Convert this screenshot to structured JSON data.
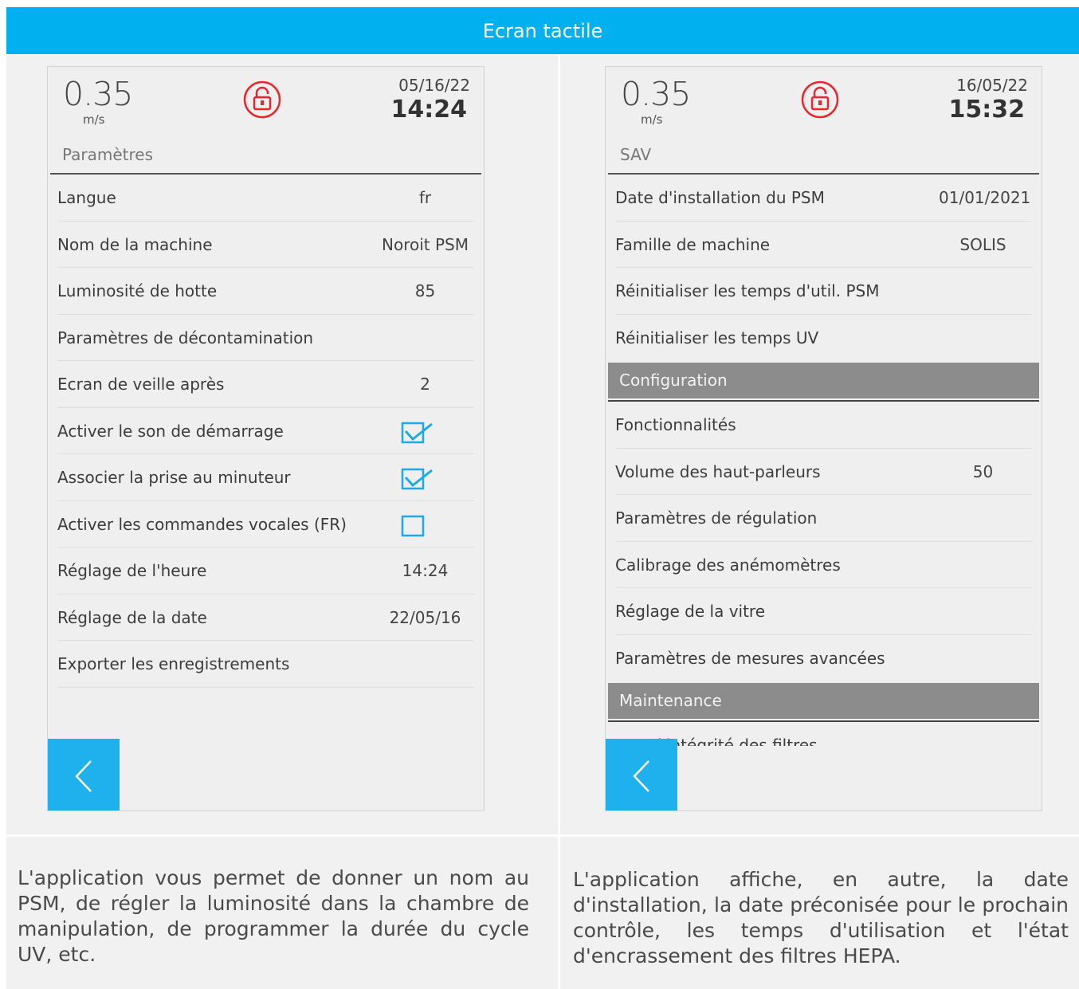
{
  "banner": {
    "title": "Ecran tactile"
  },
  "left_screen": {
    "speed": "0.35",
    "unit": "m/s",
    "date": "05/16/22",
    "time": "14:24",
    "section": "Paramètres",
    "lock_icon": "lock-icon",
    "lock_color": "#e8262b",
    "rows": [
      {
        "label": "Langue",
        "value": "fr"
      },
      {
        "label": "Nom de la machine",
        "value": "Noroit PSM"
      },
      {
        "label": "Luminosité de hotte",
        "value": "85"
      },
      {
        "label": "Paramètres de décontamination",
        "value": ""
      },
      {
        "label": "Ecran de veille après",
        "value": "2"
      },
      {
        "label": "Activer le son de démarrage",
        "checked": true
      },
      {
        "label": "Associer la prise au minuteur",
        "checked": true
      },
      {
        "label": "Activer les commandes vocales (FR)",
        "checked": false
      },
      {
        "label": "Réglage de l'heure",
        "value": "14:24"
      },
      {
        "label": "Réglage de la date",
        "value": "22/05/16"
      },
      {
        "label": "Exporter les enregistrements",
        "value": ""
      }
    ],
    "back_icon": "chevron-left-icon"
  },
  "right_screen": {
    "speed": "0.35",
    "unit": "m/s",
    "date": "16/05/22",
    "time": "15:32",
    "section": "SAV",
    "lock_icon": "lock-icon",
    "rows": [
      {
        "label": "Date d'installation du PSM",
        "value": "01/01/2021"
      },
      {
        "label": "Famille de machine",
        "value": "SOLIS"
      },
      {
        "label": "Réinitialiser les temps d'util. PSM",
        "value": ""
      },
      {
        "label": "Réinitialiser les temps UV",
        "value": ""
      }
    ],
    "config_header": "Configuration",
    "config_rows": [
      {
        "label": "Fonctionnalités",
        "value": ""
      },
      {
        "label": "Volume des haut-parleurs",
        "value": "50"
      },
      {
        "label": "Paramètres de régulation",
        "value": ""
      },
      {
        "label": "Calibrage des anémomètres",
        "value": ""
      },
      {
        "label": "Réglage de la vitre",
        "value": ""
      },
      {
        "label": "Paramètres de mesures avancées",
        "value": ""
      }
    ],
    "maintenance_header": "Maintenance",
    "partial_row": "Test d'intégrité des filtres",
    "back_icon": "chevron-left-icon"
  },
  "captions": {
    "left": "L'application vous permet de donner un nom au PSM, de régler la luminosité dans la chambre de manipulation,  de programmer la durée du cycle UV, etc.",
    "right": "L'application affiche, en autre, la date d'installation, la date préconisée pour le prochain contrôle, les temps d'utilisation et l'état d'encrassement des filtres HEPA."
  },
  "colors": {
    "accent": "#00b0ef",
    "check": "#1fa8e6",
    "header_bar": "#8c8c8c"
  }
}
